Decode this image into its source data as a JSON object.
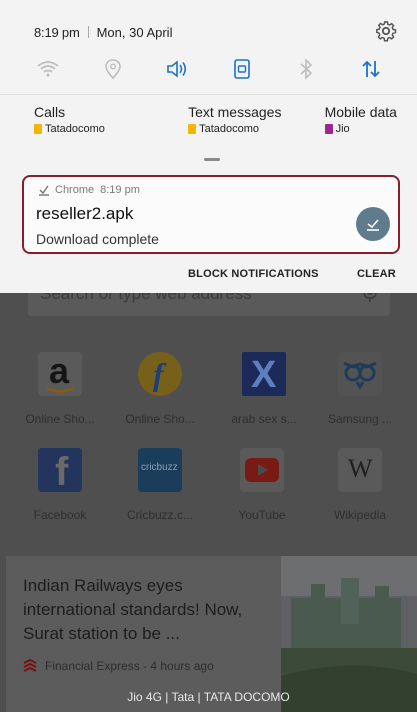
{
  "status": {
    "time": "8:19 pm",
    "date": "Mon, 30 April"
  },
  "quick_settings": [
    {
      "name": "wifi-icon",
      "state": "off"
    },
    {
      "name": "location-icon",
      "state": "off"
    },
    {
      "name": "sound-icon",
      "state": "on"
    },
    {
      "name": "screen-rotation-icon",
      "state": "on"
    },
    {
      "name": "bluetooth-icon",
      "state": "off"
    },
    {
      "name": "mobile-data-icon",
      "state": "on"
    }
  ],
  "sim": {
    "calls_label": "Calls",
    "calls_sim": "Tatadocomo",
    "sms_label": "Text messages",
    "sms_sim": "Tatadocomo",
    "data_label": "Mobile data",
    "data_sim": "Jio"
  },
  "notification": {
    "app": "Chrome",
    "time": "8:19 pm",
    "title": "reseller2.apk",
    "text": "Download complete"
  },
  "actions": {
    "block": "BLOCK NOTIFICATIONS",
    "clear": "CLEAR"
  },
  "browser": {
    "search_placeholder": "Search or type web address",
    "tiles": [
      {
        "label": "Online Sho..."
      },
      {
        "label": "Online Sho..."
      },
      {
        "label": "arab sex s..."
      },
      {
        "label": "Samsung ..."
      },
      {
        "label": "Facebook"
      },
      {
        "label": "Cricbuzz.c..."
      },
      {
        "label": "YouTube"
      },
      {
        "label": "Wikipedia"
      }
    ],
    "tile_glyphs": [
      "a",
      "f",
      "X",
      "",
      "f",
      "cricbuzz",
      "",
      "W"
    ],
    "news": {
      "title": "Indian Railways eyes international standards! Now, Surat station to be ...",
      "source": "Financial Express - 4 hours ago"
    }
  },
  "carrier_text": "Jio 4G | Tata | TATA DOCOMO",
  "colors": {
    "accent": "#1a73c9",
    "sim_tata": "#f2b705",
    "sim_jio": "#9c2a8d",
    "highlight": "#8b1c2c"
  }
}
